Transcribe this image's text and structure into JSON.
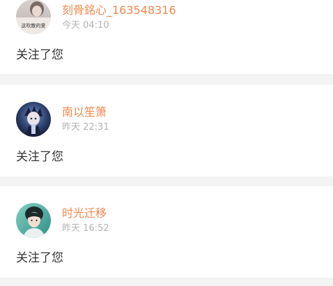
{
  "notifications": [
    {
      "username": "刻骨銘心_163548316",
      "time": "今天 04:10",
      "message": "关注了您",
      "avatar_text": "这吹散的爱"
    },
    {
      "username": "南以笙箫",
      "time": "昨天 22:31",
      "message": "关注了您"
    },
    {
      "username": "时光迁移",
      "time": "昨天 16:52",
      "message": "关注了您"
    }
  ],
  "colors": {
    "username": "#f0894e",
    "timestamp": "#b3b3b3",
    "message": "#333333",
    "background": "#f4f4f4",
    "card": "#ffffff"
  }
}
